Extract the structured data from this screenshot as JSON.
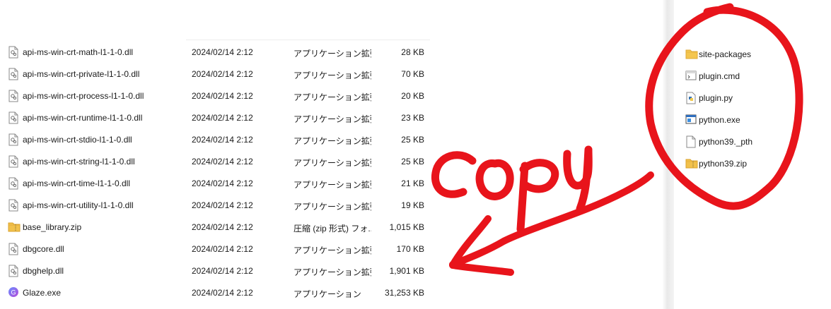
{
  "left_files": [
    {
      "name": "api-ms-win-crt-math-l1-1-0.dll",
      "date": "2024/02/14 2:12",
      "type": "アプリケーション拡張",
      "size": "28 KB",
      "icon": "dll-icon"
    },
    {
      "name": "api-ms-win-crt-private-l1-1-0.dll",
      "date": "2024/02/14 2:12",
      "type": "アプリケーション拡張",
      "size": "70 KB",
      "icon": "dll-icon"
    },
    {
      "name": "api-ms-win-crt-process-l1-1-0.dll",
      "date": "2024/02/14 2:12",
      "type": "アプリケーション拡張",
      "size": "20 KB",
      "icon": "dll-icon"
    },
    {
      "name": "api-ms-win-crt-runtime-l1-1-0.dll",
      "date": "2024/02/14 2:12",
      "type": "アプリケーション拡張",
      "size": "23 KB",
      "icon": "dll-icon"
    },
    {
      "name": "api-ms-win-crt-stdio-l1-1-0.dll",
      "date": "2024/02/14 2:12",
      "type": "アプリケーション拡張",
      "size": "25 KB",
      "icon": "dll-icon"
    },
    {
      "name": "api-ms-win-crt-string-l1-1-0.dll",
      "date": "2024/02/14 2:12",
      "type": "アプリケーション拡張",
      "size": "25 KB",
      "icon": "dll-icon"
    },
    {
      "name": "api-ms-win-crt-time-l1-1-0.dll",
      "date": "2024/02/14 2:12",
      "type": "アプリケーション拡張",
      "size": "21 KB",
      "icon": "dll-icon"
    },
    {
      "name": "api-ms-win-crt-utility-l1-1-0.dll",
      "date": "2024/02/14 2:12",
      "type": "アプリケーション拡張",
      "size": "19 KB",
      "icon": "dll-icon"
    },
    {
      "name": "base_library.zip",
      "date": "2024/02/14 2:12",
      "type": "圧縮 (zip 形式) フォ...",
      "size": "1,015 KB",
      "icon": "zip-folder-icon"
    },
    {
      "name": "dbgcore.dll",
      "date": "2024/02/14 2:12",
      "type": "アプリケーション拡張",
      "size": "170 KB",
      "icon": "dll-icon"
    },
    {
      "name": "dbghelp.dll",
      "date": "2024/02/14 2:12",
      "type": "アプリケーション拡張",
      "size": "1,901 KB",
      "icon": "dll-icon"
    },
    {
      "name": "Glaze.exe",
      "date": "2024/02/14 2:12",
      "type": "アプリケーション",
      "size": "31,253 KB",
      "icon": "glaze-app-icon"
    }
  ],
  "right_files": [
    {
      "name": "site-packages",
      "icon": "folder-icon"
    },
    {
      "name": "plugin.cmd",
      "icon": "cmd-file-icon"
    },
    {
      "name": "plugin.py",
      "icon": "python-file-icon"
    },
    {
      "name": "python.exe",
      "icon": "exe-window-icon"
    },
    {
      "name": "python39._pth",
      "icon": "blank-file-icon"
    },
    {
      "name": "python39.zip",
      "icon": "zip-folder-icon"
    }
  ],
  "annotation": {
    "text": "COPY",
    "color": "#e8141b"
  }
}
